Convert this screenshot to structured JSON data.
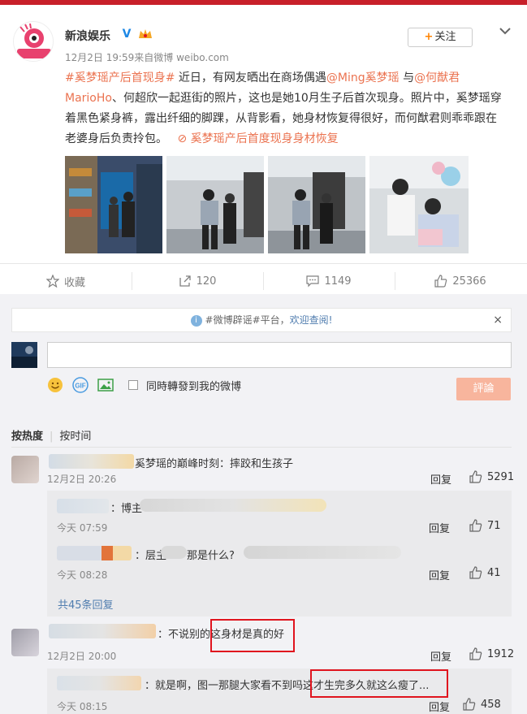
{
  "post": {
    "author": "新浪娱乐",
    "verified_mark": "V",
    "avatar_text": "新浪娱乐",
    "follow_label": "关注",
    "follow_plus": "+",
    "meta": "12月2日 19:59来自微博 weibo.com",
    "content": {
      "hashtag": "#奚梦瑶产后首现身#",
      "t1": " 近日，有网友晒出在商场偶遇",
      "mention1": "@Ming奚梦瑶",
      "t2": " 与",
      "mention2": "@何猷君MarioHo",
      "t3": "、何超欣一起逛街的照片，这也是她10月生子后首次现身。照片中，奚梦瑶穿着黑色紧身裤，露出纤细的脚踝，从背影看，她身材恢复得很好，而何猷君则乖乖跟在老婆身后负责拎包。",
      "card_link": "奚梦瑶产后首度现身身材恢复"
    },
    "actions": {
      "favorite": "收藏",
      "repost": "120",
      "comment": "1149",
      "like": "25366"
    }
  },
  "comment_area": {
    "notice_prefix": "#微博辟谣#平台，",
    "notice_link": "欢迎查阅!",
    "notice_close": "×",
    "also_repost_label": "同時轉發到我的微博",
    "submit_label": "評論",
    "sort_hot": "按热度",
    "sort_time": "按时间"
  },
  "comments": [
    {
      "text": "奚梦瑶的巅峰时刻：摔跤和生孩子",
      "time": "12月2日 20:26",
      "reply": "回复",
      "likes": "5291",
      "subs": [
        {
          "text": "：博主",
          "time": "今天 07:59",
          "reply": "回复",
          "likes": "71"
        },
        {
          "text": "：层主",
          "text2": "那是什么?",
          "time": "今天 08:28",
          "reply": "回复",
          "likes": "41"
        }
      ],
      "more": "共45条回复"
    },
    {
      "text_before": "：不说别的",
      "text_highlight": "这身材是真的好",
      "time": "12月2日 20:00",
      "reply": "回复",
      "likes": "1912",
      "subs": [
        {
          "text_before": "：就是啊，图一那腿大家看不到吗",
          "text_highlight": "这才生完多久就这么瘦了...",
          "time": "今天 08:15",
          "reply": "回复",
          "likes": "458"
        }
      ]
    }
  ],
  "colors": {
    "link": "#eb7350",
    "accent_orange": "#ff8200",
    "highlight_box": "#e0141e",
    "submit_bg": "#f8b59d",
    "comment_bg": "#f2f2f5"
  }
}
